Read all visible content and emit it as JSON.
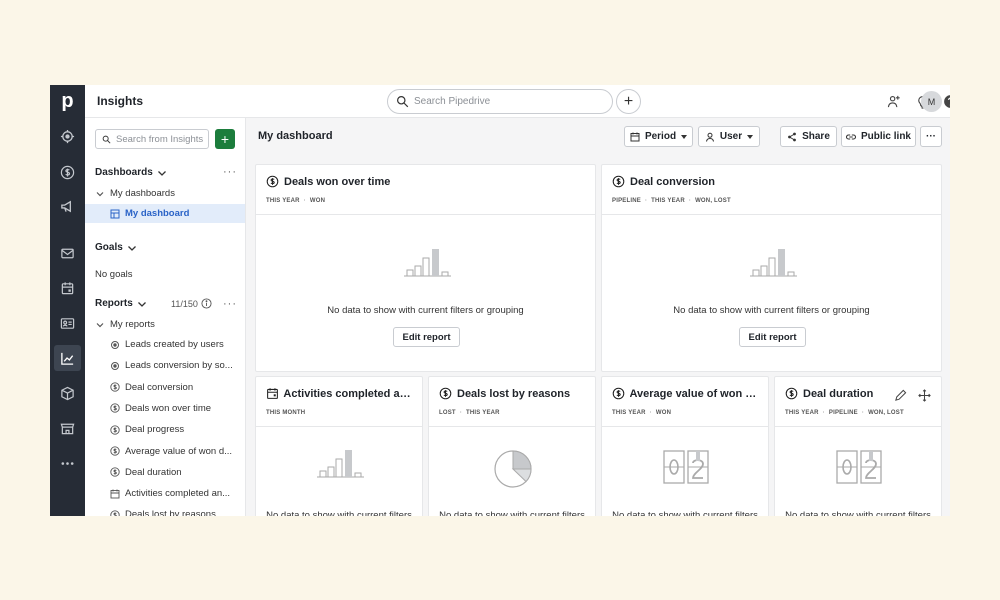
{
  "app": {
    "logo": "p",
    "page_title": "Insights",
    "avatar_initial": "M"
  },
  "search": {
    "placeholder": "Search Pipedrive"
  },
  "sidebar": {
    "search_placeholder": "Search from Insights",
    "add_label": "+",
    "dashboards_title": "Dashboards",
    "my_dashboards": "My dashboards",
    "my_dashboard": "My dashboard",
    "goals_title": "Goals",
    "no_goals": "No goals",
    "reports_title": "Reports",
    "reports_count": "11/150",
    "my_reports": "My reports",
    "reports": [
      {
        "label": "Leads created by users",
        "icon": "target-icon"
      },
      {
        "label": "Leads conversion by so...",
        "icon": "target-icon"
      },
      {
        "label": "Deal conversion",
        "icon": "dollar-icon"
      },
      {
        "label": "Deals won over time",
        "icon": "dollar-icon"
      },
      {
        "label": "Deal progress",
        "icon": "dollar-icon"
      },
      {
        "label": "Average value of won d...",
        "icon": "dollar-icon"
      },
      {
        "label": "Deal duration",
        "icon": "dollar-icon"
      },
      {
        "label": "Activities completed an...",
        "icon": "calendar-icon"
      },
      {
        "label": "Deals lost by reasons",
        "icon": "dollar-icon"
      }
    ]
  },
  "toolbar": {
    "dashboard_title": "My dashboard",
    "period": "Period",
    "user": "User",
    "share": "Share",
    "public_link": "Public link",
    "more": "···"
  },
  "cards": [
    {
      "title": "Deals won over time",
      "tags": [
        "THIS YEAR",
        "WON"
      ],
      "message": "No data to show with current filters or grouping",
      "edit": "Edit report",
      "icon": "dollar-icon",
      "illustration": "bar-chart"
    },
    {
      "title": "Deal conversion",
      "tags": [
        "PIPELINE",
        "THIS YEAR",
        "WON, LOST"
      ],
      "message": "No data to show with current filters or grouping",
      "edit": "Edit report",
      "icon": "dollar-icon",
      "illustration": "bar-chart"
    },
    {
      "title": "Activities completed and...",
      "tags": [
        "THIS MONTH"
      ],
      "message": "No data to show with current filters",
      "icon": "calendar-icon",
      "illustration": "bar-chart"
    },
    {
      "title": "Deals lost by reasons",
      "tags": [
        "LOST",
        "THIS YEAR"
      ],
      "message": "No data to show with current filters",
      "icon": "dollar-icon",
      "illustration": "pie-chart"
    },
    {
      "title": "Average value of won de...",
      "tags": [
        "THIS YEAR",
        "WON"
      ],
      "message": "No data to show with current filters",
      "icon": "dollar-icon",
      "illustration": "counter"
    },
    {
      "title": "Deal duration",
      "tags": [
        "THIS YEAR",
        "PIPELINE",
        "WON, LOST"
      ],
      "message": "No data to show with current filters",
      "icon": "dollar-icon",
      "illustration": "counter"
    }
  ],
  "colors": {
    "nav_bg": "#262c36",
    "accent_blue": "#2a63c7",
    "add_green": "#1c7d3c",
    "selected_bg": "#e2ecfa"
  }
}
